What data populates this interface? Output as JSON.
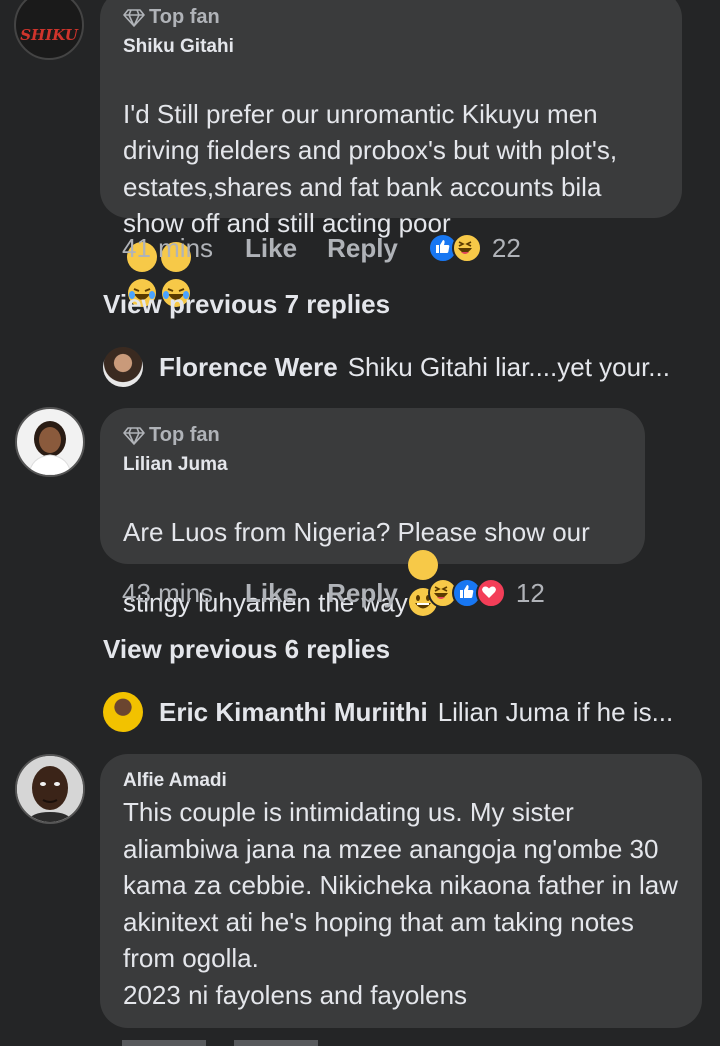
{
  "comments": [
    {
      "badge": "Top fan",
      "author": "Shiku Gitahi",
      "text": "I'd Still prefer our unromantic Kikuyu men driving fielders and probox's but with plot's, estates,shares and fat bank accounts bila show off and still acting poor",
      "time": "41 mins",
      "like": "Like",
      "reply": "Reply",
      "reaction_count": "22",
      "avatar_text": "SHIKU",
      "view_previous": "View previous 7 replies",
      "latest_reply": {
        "name": "Florence Were",
        "text": "Shiku Gitahi liar....yet your..."
      }
    },
    {
      "badge": "Top fan",
      "author": "Lilian Juma",
      "text": "Are Luos from Nigeria? Please show our stingy luhyamen the way",
      "time": "43 mins",
      "like": "Like",
      "reply": "Reply",
      "reaction_count": "12",
      "view_previous": "View previous 6 replies",
      "latest_reply": {
        "name": "Eric Kimanthi Muriithi",
        "text": "Lilian Juma if he is..."
      }
    },
    {
      "author": "Alfie Amadi",
      "text": "This couple is intimidating us. My sister aliambiwa jana na mzee anangoja ng'ombe 30 kama za cebbie. Nikicheka nikaona father in law akinitext ati he's hoping that am taking notes from ogolla.\n2023 ni fayolens and fayolens"
    }
  ],
  "icons": {
    "badge": "diamond-icon",
    "like_reaction": "like-reaction-icon",
    "haha_reaction": "haha-reaction-icon",
    "love_reaction": "love-reaction-icon"
  },
  "colors": {
    "background": "#242526",
    "bubble": "#3a3b3c",
    "like_blue": "#1877f2",
    "love_red": "#f33e58",
    "haha_yellow": "#f7c948"
  }
}
